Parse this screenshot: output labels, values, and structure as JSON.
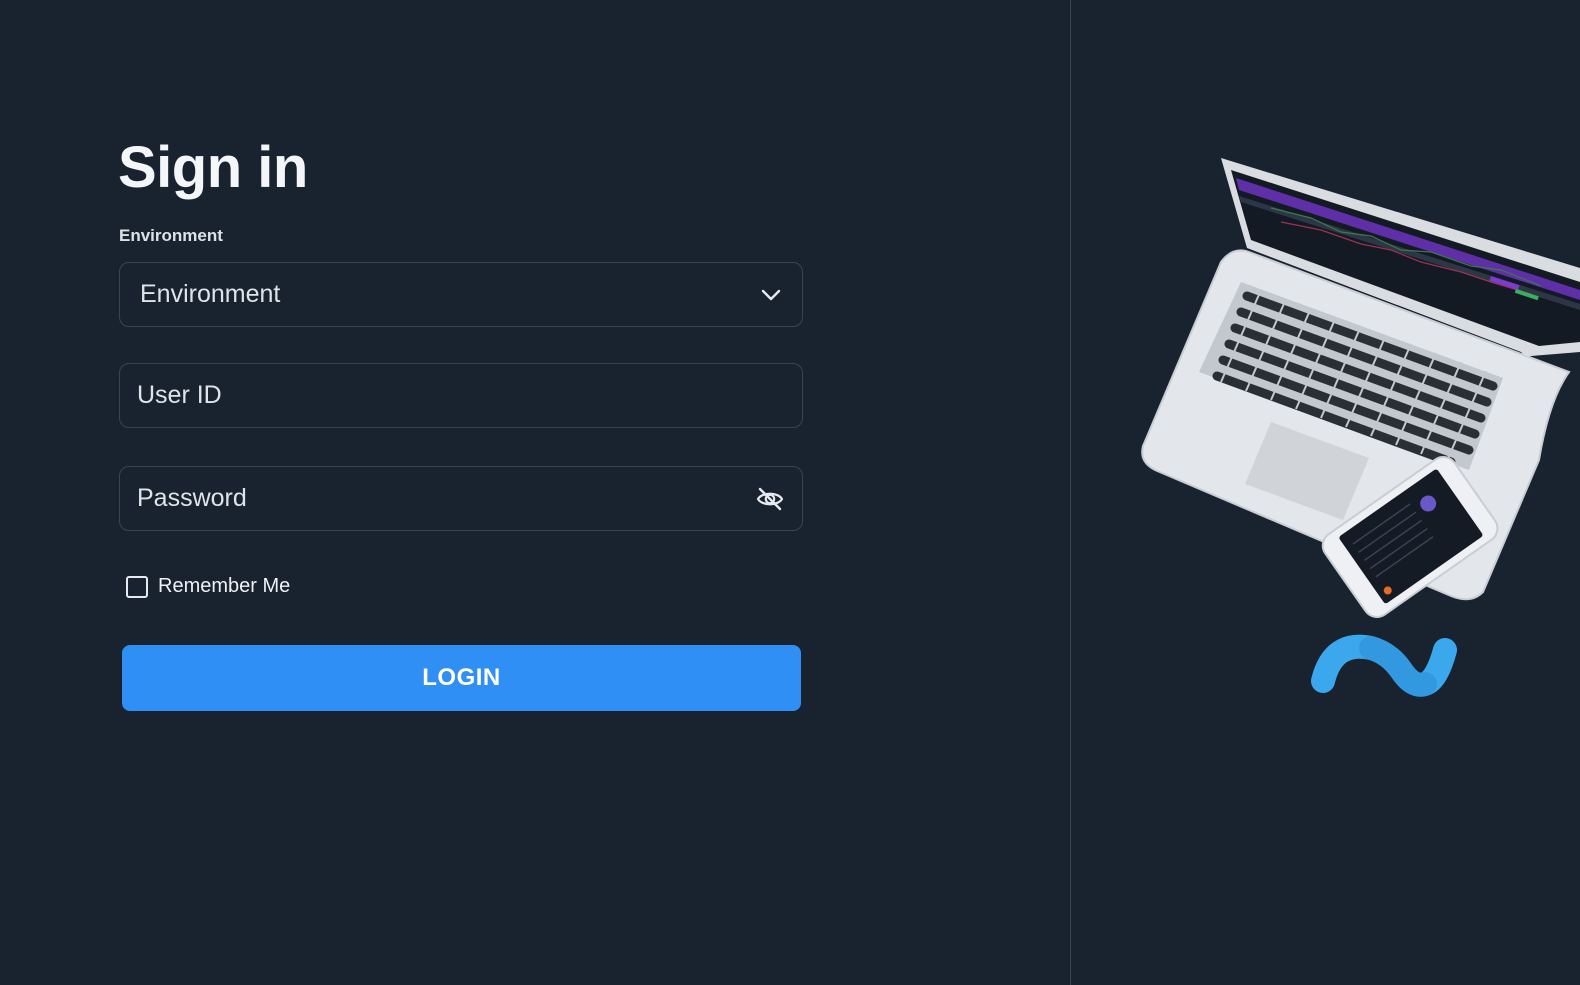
{
  "signin": {
    "title": "Sign in",
    "environment_label": "Environment",
    "environment_value": "Environment",
    "user_id_placeholder": "User ID",
    "password_placeholder": "Password",
    "remember_me_label": "Remember Me",
    "remember_me_checked": false,
    "login_label": "LOGIN"
  },
  "icons": {
    "environment_dropdown": "chevron-down-icon",
    "password_toggle": "eye-off-icon",
    "illustration": "laptop-phone-illustration",
    "brand_logo": "wave-logo"
  },
  "colors": {
    "background": "#19222f",
    "border": "#3a4452",
    "accent": "#2f8ff5",
    "logo": "#3ba8ee"
  }
}
